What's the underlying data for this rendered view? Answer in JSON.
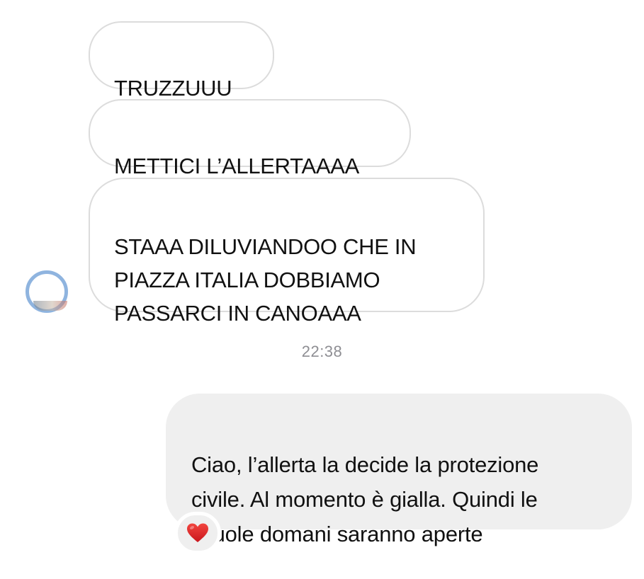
{
  "conversation": {
    "incoming_messages": [
      {
        "text": "TRUZZUUU"
      },
      {
        "text": "METTICI L’ALLERTAAAA"
      },
      {
        "text": "STAAA DILUVIANDOO CHE IN\nPIAZZA ITALIA DOBBIAMO\nPASSARCI IN CANOAAA"
      }
    ],
    "timestamp": "22:38",
    "outgoing_message": {
      "text": "Ciao, l’allerta la decide la protezione\ncivile. Al momento è gialla. Quindi le\nscuole domani saranno aperte",
      "reaction_icon": "red-heart-icon"
    }
  },
  "colors": {
    "incoming_bubble_border": "#dcdcdc",
    "outgoing_bubble_bg": "#efefef",
    "timestamp": "#8e8e93",
    "heart": "#e0242b"
  }
}
